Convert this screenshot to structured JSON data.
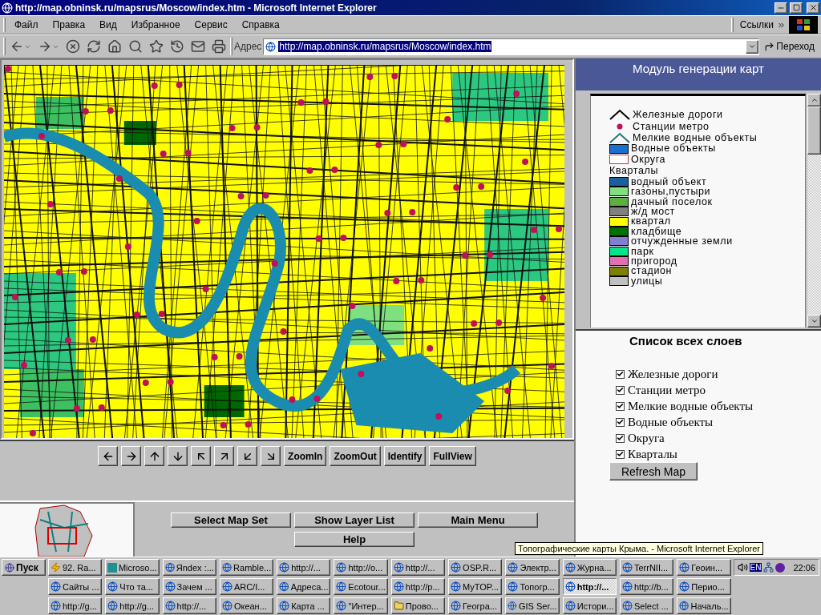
{
  "window": {
    "title": "http://map.obninsk.ru/mapsrus/Moscow/index.htm - Microsoft Internet Explorer"
  },
  "menu": [
    "Файл",
    "Правка",
    "Вид",
    "Избранное",
    "Сервис",
    "Справка"
  ],
  "links_label": "Ссылки",
  "address": {
    "label": "Адрес",
    "value": "http://map.obninsk.ru/mapsrus/Moscow/index.htm",
    "selected": true,
    "go": "Переход"
  },
  "map_tools": [
    "ZoomIn",
    "ZoomOut",
    "Identify",
    "FullView"
  ],
  "page_buttons": [
    "Select Map Set",
    "Show Layer List",
    "Main Menu",
    "Help"
  ],
  "header": "Модуль генерации карт",
  "legend": [
    {
      "kind": "line",
      "label": "Железные дороги",
      "color": "#000000"
    },
    {
      "kind": "dot",
      "label": "Станции метро",
      "color": "#c0105a"
    },
    {
      "kind": "line",
      "label": "Мелкие водные объекты",
      "color": "#207878"
    },
    {
      "kind": "fill",
      "label": "Водные объекты",
      "color": "#1a70d0"
    },
    {
      "kind": "outline",
      "label": "Округа",
      "color": "#b04040"
    },
    {
      "kind": "heading",
      "label": "Кварталы"
    },
    {
      "kind": "fill",
      "label": "водный объект",
      "color": "#1a60a0"
    },
    {
      "kind": "fill",
      "label": "газоны,пустыри",
      "color": "#80e080"
    },
    {
      "kind": "fill",
      "label": "дачный поселок",
      "color": "#5cb040"
    },
    {
      "kind": "fill",
      "label": "ж/д мост",
      "color": "#808080"
    },
    {
      "kind": "fill",
      "label": "квартал",
      "color": "#ffff00"
    },
    {
      "kind": "fill",
      "label": "кладбище",
      "color": "#007000"
    },
    {
      "kind": "fill",
      "label": "отчужденные земли",
      "color": "#8080d0"
    },
    {
      "kind": "fill",
      "label": "парк",
      "color": "#00e88a"
    },
    {
      "kind": "fill",
      "label": "пригород",
      "color": "#e070b0"
    },
    {
      "kind": "fill",
      "label": "стадион",
      "color": "#808000"
    },
    {
      "kind": "fill",
      "label": "улицы",
      "color": "#c0c0c0"
    }
  ],
  "layers": {
    "title": "Список всех слоев",
    "items": [
      {
        "label": "Железные дороги",
        "checked": true
      },
      {
        "label": "Станции метро",
        "checked": true
      },
      {
        "label": "Мелкие водные объекты",
        "checked": true
      },
      {
        "label": "Водные объекты",
        "checked": true
      },
      {
        "label": "Округа",
        "checked": true
      },
      {
        "label": "Кварталы",
        "checked": true
      }
    ],
    "button": "Refresh Map"
  },
  "taskbar": {
    "start": "Пуск",
    "rows": [
      [
        {
          "label": "92. Ra...",
          "kind": "bolt",
          "selected": false
        },
        {
          "label": "Microso...",
          "kind": "doc",
          "selected": false
        },
        {
          "label": "Яndex :...",
          "kind": "browser",
          "selected": false
        },
        {
          "label": "Ramble...",
          "kind": "browser",
          "selected": false
        },
        {
          "label": "http://...",
          "kind": "browser",
          "selected": false
        },
        {
          "label": "http://o...",
          "kind": "browser",
          "selected": false
        },
        {
          "label": "http://...",
          "kind": "browser",
          "selected": false
        },
        {
          "label": "OSP.R...",
          "kind": "browser",
          "selected": false
        },
        {
          "label": "Электр...",
          "kind": "browser",
          "selected": false
        },
        {
          "label": "Журна...",
          "kind": "browser",
          "selected": false
        },
        {
          "label": "TerrNII...",
          "kind": "browser",
          "selected": false
        },
        {
          "label": "Геоин...",
          "kind": "browser",
          "selected": false
        }
      ],
      [
        {
          "label": "Сайты ...",
          "kind": "browser",
          "selected": false
        },
        {
          "label": "Что та...",
          "kind": "browser",
          "selected": false
        },
        {
          "label": "Зачем ...",
          "kind": "browser",
          "selected": false
        },
        {
          "label": "ARC/I...",
          "kind": "browser",
          "selected": false
        },
        {
          "label": "Адреса...",
          "kind": "browser",
          "selected": false
        },
        {
          "label": "Ecotour...",
          "kind": "browser",
          "selected": false
        },
        {
          "label": "http://p...",
          "kind": "browser",
          "selected": false
        },
        {
          "label": "MyTOP...",
          "kind": "browser",
          "selected": false
        },
        {
          "label": "Топогр...",
          "kind": "browser",
          "selected": false
        },
        {
          "label": "http://...",
          "kind": "browser",
          "selected": true
        },
        {
          "label": "http://b...",
          "kind": "browser",
          "selected": false
        },
        {
          "label": "Перио...",
          "kind": "browser",
          "selected": false
        }
      ],
      [
        {
          "label": "http://g...",
          "kind": "browser",
          "selected": false
        },
        {
          "label": "http://g...",
          "kind": "browser",
          "selected": false
        },
        {
          "label": "http://...",
          "kind": "browser",
          "selected": false
        },
        {
          "label": "Океан...",
          "kind": "browser",
          "selected": false
        },
        {
          "label": "Карта ...",
          "kind": "browser",
          "selected": false
        },
        {
          "label": "\"Интер...",
          "kind": "browser",
          "selected": false
        },
        {
          "label": "Прово...",
          "kind": "folder",
          "selected": false
        },
        {
          "label": "Геогра...",
          "kind": "browser",
          "selected": false
        },
        {
          "label": "GIS Ser...",
          "kind": "browser",
          "selected": false
        },
        {
          "label": "Истори...",
          "kind": "browser",
          "selected": false
        },
        {
          "label": "Select ...",
          "kind": "browser",
          "selected": false
        },
        {
          "label": "Началь...",
          "kind": "browser",
          "selected": false
        }
      ]
    ],
    "tooltip": "Топографические карты Крыма. - Microsoft Internet Explorer",
    "language": "EN",
    "clock": "22:06"
  }
}
